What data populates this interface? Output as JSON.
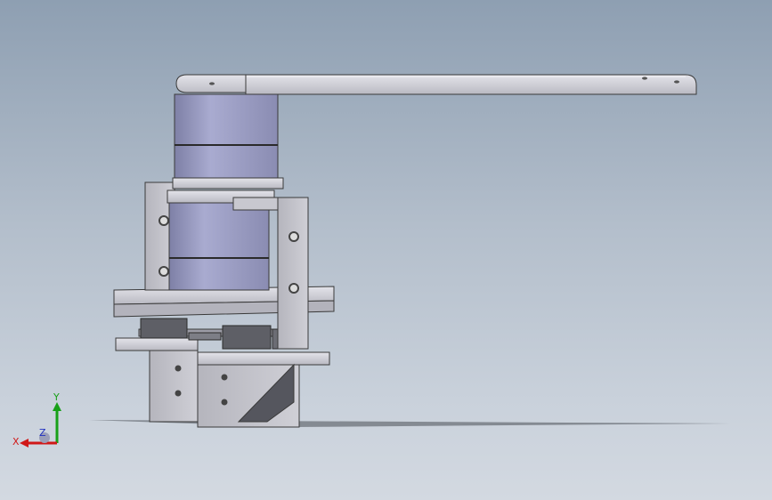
{
  "viewport": {
    "background_top": "#8e9fb2",
    "background_bottom": "#d3d9e1"
  },
  "model": {
    "part_color": "#c3c3cb",
    "cylinder_color": "#9a9cc0",
    "edge_color": "#3a3a3a"
  },
  "triad": {
    "x_label": "X",
    "y_label": "Y",
    "z_label": "Z",
    "x_color": "#d01818",
    "y_color": "#18a018",
    "z_color": "#2030c0"
  }
}
